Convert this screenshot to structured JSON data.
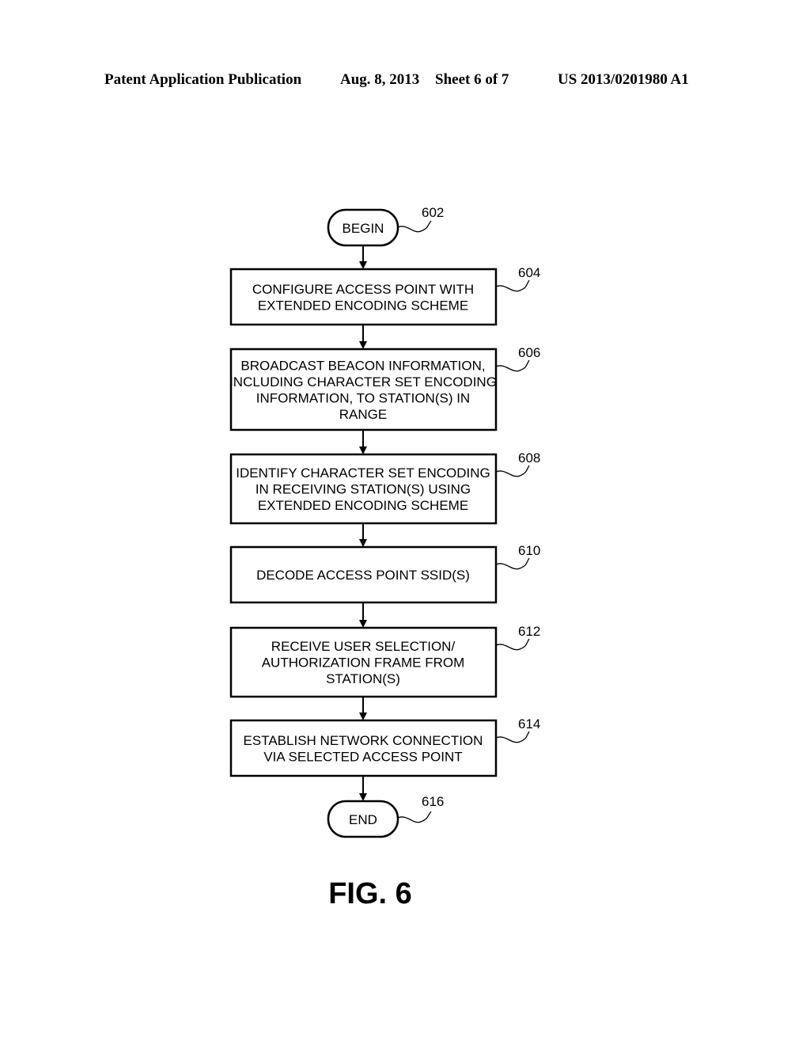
{
  "header": {
    "publication_type": "Patent Application Publication",
    "date": "Aug. 8, 2013",
    "sheet": "Sheet 6 of 7",
    "publication_number": "US 2013/0201980 A1"
  },
  "flowchart": {
    "begin": {
      "label": "BEGIN",
      "ref": "602"
    },
    "steps": [
      {
        "ref": "604",
        "lines": [
          "CONFIGURE ACCESS POINT WITH",
          "EXTENDED ENCODING SCHEME"
        ]
      },
      {
        "ref": "606",
        "lines": [
          "BROADCAST BEACON INFORMATION,",
          "INCLUDING CHARACTER SET ENCODING",
          "INFORMATION, TO STATION(S) IN",
          "RANGE"
        ]
      },
      {
        "ref": "608",
        "lines": [
          "IDENTIFY CHARACTER SET ENCODING",
          "IN RECEIVING STATION(S) USING",
          "EXTENDED ENCODING SCHEME"
        ]
      },
      {
        "ref": "610",
        "lines": [
          "DECODE ACCESS POINT SSID(S)"
        ]
      },
      {
        "ref": "612",
        "lines": [
          "RECEIVE USER SELECTION/",
          "AUTHORIZATION FRAME FROM",
          "STATION(S)"
        ]
      },
      {
        "ref": "614",
        "lines": [
          "ESTABLISH NETWORK CONNECTION",
          "VIA SELECTED ACCESS POINT"
        ]
      }
    ],
    "end": {
      "label": "END",
      "ref": "616"
    }
  },
  "figure_label": "FIG. 6"
}
